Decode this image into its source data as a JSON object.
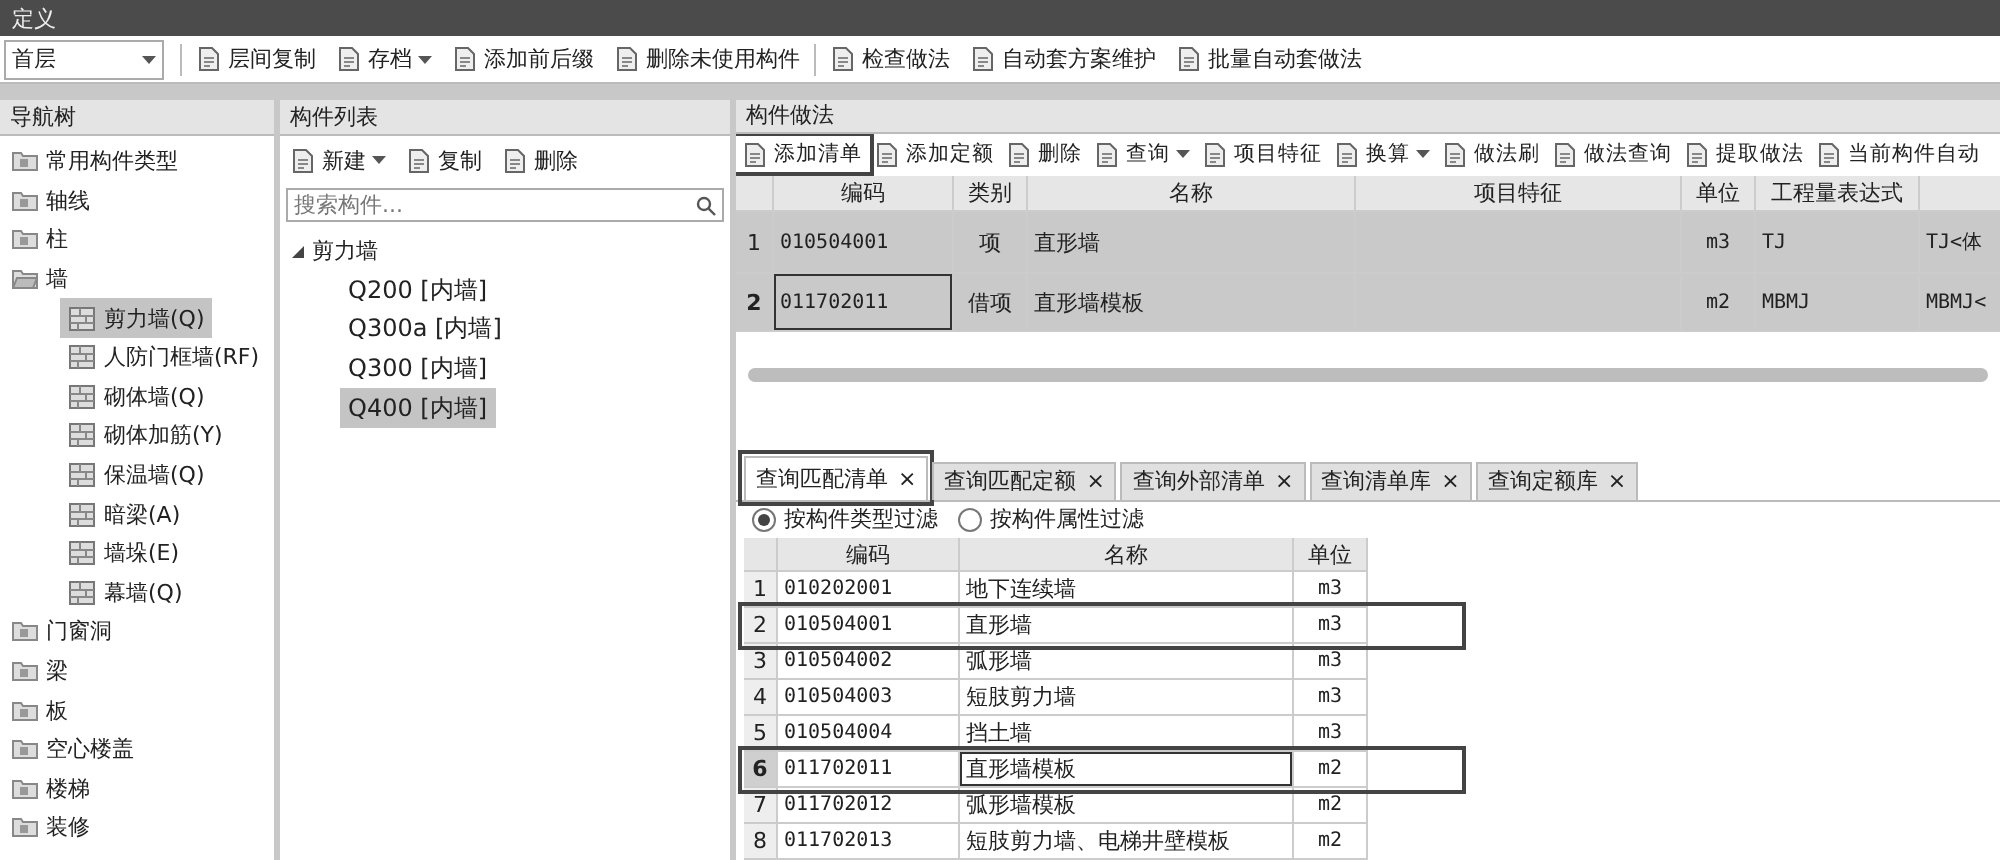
{
  "window": {
    "title": "定义"
  },
  "toolbar": {
    "floor": "首层",
    "buttons": [
      {
        "label": "层间复制",
        "dropdown": false
      },
      {
        "label": "存档",
        "dropdown": true
      },
      {
        "label": "添加前后缀",
        "dropdown": false
      },
      {
        "label": "删除未使用构件",
        "dropdown": false
      },
      {
        "label": "检查做法",
        "dropdown": false
      },
      {
        "label": "自动套方案维护",
        "dropdown": false
      },
      {
        "label": "批量自动套做法",
        "dropdown": false
      }
    ]
  },
  "nav_tree": {
    "title": "导航树",
    "items": [
      {
        "label": "常用构件类型",
        "expanded": false
      },
      {
        "label": "轴线",
        "expanded": false
      },
      {
        "label": "柱",
        "expanded": false
      },
      {
        "label": "墙",
        "expanded": true,
        "children": [
          {
            "label": "剪力墙(Q)",
            "selected": true
          },
          {
            "label": "人防门框墙(RF)",
            "selected": false
          },
          {
            "label": "砌体墙(Q)",
            "selected": false
          },
          {
            "label": "砌体加筋(Y)",
            "selected": false
          },
          {
            "label": "保温墙(Q)",
            "selected": false
          },
          {
            "label": "暗梁(A)",
            "selected": false
          },
          {
            "label": "墙垛(E)",
            "selected": false
          },
          {
            "label": "幕墙(Q)",
            "selected": false
          }
        ]
      },
      {
        "label": "门窗洞",
        "expanded": false
      },
      {
        "label": "梁",
        "expanded": false
      },
      {
        "label": "板",
        "expanded": false
      },
      {
        "label": "空心楼盖",
        "expanded": false
      },
      {
        "label": "楼梯",
        "expanded": false
      },
      {
        "label": "装修",
        "expanded": false
      }
    ]
  },
  "component_list": {
    "title": "构件列表",
    "toolbar": [
      {
        "label": "新建",
        "dropdown": true
      },
      {
        "label": "复制",
        "dropdown": false
      },
      {
        "label": "删除",
        "dropdown": false
      }
    ],
    "search": {
      "placeholder": "搜索构件..."
    },
    "tree": {
      "label": "剪力墙",
      "expanded": true,
      "children": [
        {
          "label": "Q200 [内墙]",
          "selected": false
        },
        {
          "label": "Q300a [内墙]",
          "selected": false
        },
        {
          "label": "Q300 [内墙]",
          "selected": false
        },
        {
          "label": "Q400 [内墙]",
          "selected": true
        }
      ]
    }
  },
  "methods": {
    "title": "构件做法",
    "toolbar": [
      {
        "label": "添加清单",
        "dropdown": false,
        "highlighted": true
      },
      {
        "label": "添加定额",
        "dropdown": false,
        "highlighted": false
      },
      {
        "label": "删除",
        "dropdown": false,
        "highlighted": false
      },
      {
        "label": "查询",
        "dropdown": true,
        "highlighted": false
      },
      {
        "label": "项目特征",
        "dropdown": false,
        "highlighted": false
      },
      {
        "label": "换算",
        "dropdown": true,
        "highlighted": false
      },
      {
        "label": "做法刷",
        "dropdown": false,
        "highlighted": false
      },
      {
        "label": "做法查询",
        "dropdown": false,
        "highlighted": false
      },
      {
        "label": "提取做法",
        "dropdown": false,
        "highlighted": false
      },
      {
        "label": "当前构件自动",
        "dropdown": false,
        "highlighted": false
      }
    ],
    "table": {
      "columns": [
        "编码",
        "类别",
        "名称",
        "项目特征",
        "单位",
        "工程量表达式"
      ],
      "rows": [
        {
          "number": "1",
          "code": "010504001",
          "category": "项",
          "name": "直形墙",
          "unit": "m3",
          "expression": "TJ",
          "column_8": "TJ<体",
          "current": false
        },
        {
          "number": "2",
          "code": "011702011",
          "category": "借项",
          "name": "直形墙模板",
          "unit": "m2",
          "expression": "MBMJ",
          "column_8": "MBMJ<",
          "current": true
        }
      ]
    }
  },
  "query": {
    "tabs": [
      {
        "label": "查询匹配清单",
        "close": "×",
        "selected": true,
        "highlighted": true
      },
      {
        "label": "查询匹配定额",
        "close": "×",
        "selected": false,
        "highlighted": false
      },
      {
        "label": "查询外部清单",
        "close": "×",
        "selected": false,
        "highlighted": false
      },
      {
        "label": "查询清单库",
        "close": "×",
        "selected": false,
        "highlighted": false
      },
      {
        "label": "查询定额库",
        "close": "×",
        "selected": false,
        "highlighted": false
      }
    ],
    "filters": [
      {
        "label": "按构件类型过滤",
        "selected": true
      },
      {
        "label": "按构件属性过滤",
        "selected": false
      }
    ],
    "table": {
      "columns": [
        "编码",
        "名称",
        "单位"
      ],
      "rows": [
        {
          "number": "1",
          "code": "010202001",
          "name": "地下连续墙",
          "unit": "m3",
          "selected": false,
          "highlighted": false
        },
        {
          "number": "2",
          "code": "010504001",
          "name": "直形墙",
          "unit": "m3",
          "selected": false,
          "highlighted": true
        },
        {
          "number": "3",
          "code": "010504002",
          "name": "弧形墙",
          "unit": "m3",
          "selected": false,
          "highlighted": false
        },
        {
          "number": "4",
          "code": "010504003",
          "name": "短肢剪力墙",
          "unit": "m3",
          "selected": false,
          "highlighted": false
        },
        {
          "number": "5",
          "code": "010504004",
          "name": "挡土墙",
          "unit": "m3",
          "selected": false,
          "highlighted": false
        },
        {
          "number": "6",
          "code": "011702011",
          "name": "直形墙模板",
          "unit": "m2",
          "selected": true,
          "highlighted": true
        },
        {
          "number": "7",
          "code": "011702012",
          "name": "弧形墙模板",
          "unit": "m2",
          "selected": false,
          "highlighted": false
        },
        {
          "number": "8",
          "code": "011702013",
          "name": "短肢剪力墙、电梯井壁模板",
          "unit": "m2",
          "selected": false,
          "highlighted": false
        }
      ]
    }
  }
}
